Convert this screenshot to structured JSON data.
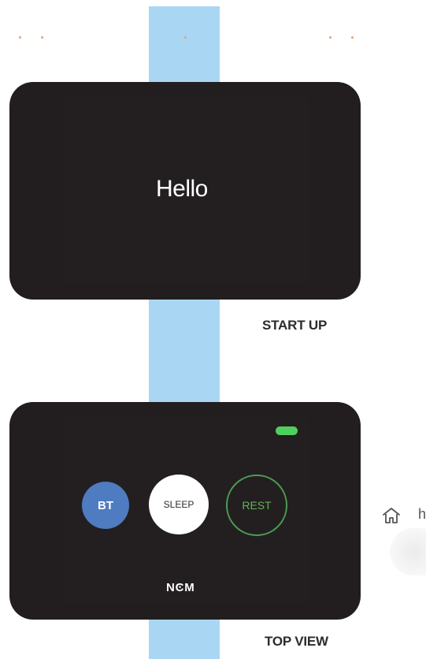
{
  "startup": {
    "greeting": "Hello",
    "caption": "START UP"
  },
  "top_view": {
    "battery_status": "green",
    "buttons": {
      "bt": "BT",
      "sleep": "SLEEP",
      "rest": "REST"
    },
    "brand": "NϾM",
    "caption": "TOP VIEW"
  },
  "side_panel": {
    "icon": "home-icon",
    "partial_label": "h"
  },
  "colors": {
    "device": "#221e1f",
    "strap": "#a9d6f2",
    "bt_button": "#4f7bc0",
    "rest_ring": "#4b9b52",
    "battery": "#4fcf5d"
  }
}
